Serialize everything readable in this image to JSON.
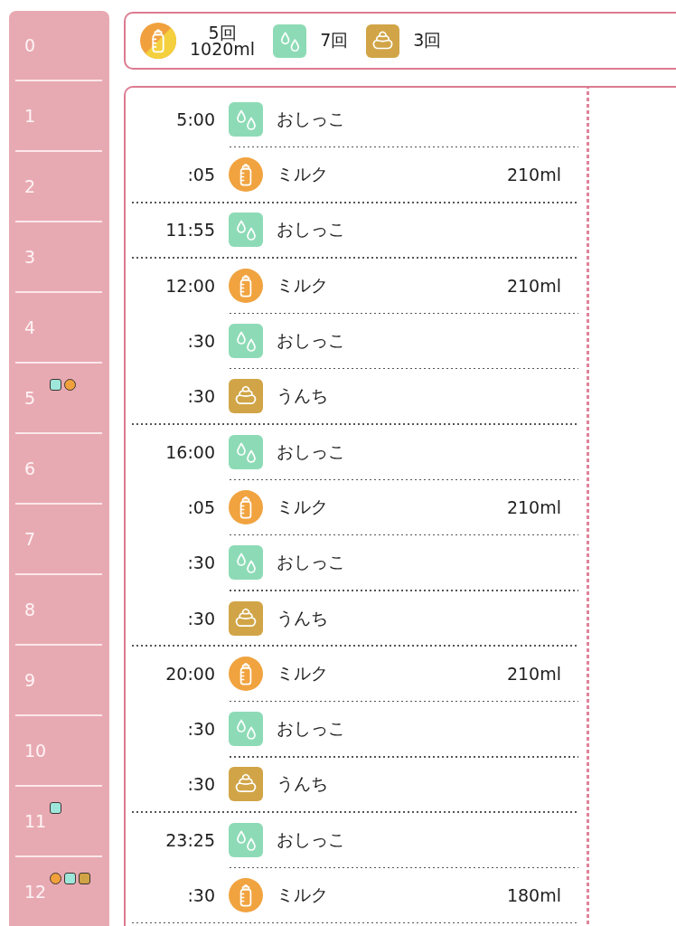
{
  "hours": [
    {
      "label": "0"
    },
    {
      "label": "1"
    },
    {
      "label": "2"
    },
    {
      "label": "3"
    },
    {
      "label": "4"
    },
    {
      "label": "5",
      "markers": [
        {
          "kind": "pee"
        },
        {
          "kind": "milk"
        }
      ]
    },
    {
      "label": "6"
    },
    {
      "label": "7"
    },
    {
      "label": "8"
    },
    {
      "label": "9"
    },
    {
      "label": "10"
    },
    {
      "label": "11",
      "markers": [
        {
          "kind": "pee"
        }
      ]
    },
    {
      "label": "12",
      "markers": [
        {
          "kind": "milk"
        },
        {
          "kind": "pee"
        },
        {
          "kind": "poop"
        }
      ]
    }
  ],
  "summary": {
    "items": [
      {
        "kind": "milk",
        "count": "5回",
        "amount": "1020ml"
      },
      {
        "kind": "pee",
        "count": "7回"
      },
      {
        "kind": "poop",
        "count": "3回"
      }
    ]
  },
  "log": {
    "groups": [
      {
        "entries": [
          {
            "time": "5:00",
            "kind": "pee",
            "label": "おしっこ"
          },
          {
            "time": ":05",
            "kind": "milk",
            "label": "ミルク",
            "amount": "210ml"
          }
        ]
      },
      {
        "entries": [
          {
            "time": "11:55",
            "kind": "pee",
            "label": "おしっこ"
          }
        ]
      },
      {
        "entries": [
          {
            "time": "12:00",
            "kind": "milk",
            "label": "ミルク",
            "amount": "210ml"
          },
          {
            "time": ":30",
            "kind": "pee",
            "label": "おしっこ"
          },
          {
            "time": ":30",
            "kind": "poop",
            "label": "うんち"
          }
        ]
      },
      {
        "entries": [
          {
            "time": "16:00",
            "kind": "pee",
            "label": "おしっこ"
          },
          {
            "time": ":05",
            "kind": "milk",
            "label": "ミルク",
            "amount": "210ml"
          },
          {
            "time": ":30",
            "kind": "pee",
            "label": "おしっこ"
          },
          {
            "time": ":30",
            "kind": "poop",
            "label": "うんち"
          }
        ]
      },
      {
        "entries": [
          {
            "time": "20:00",
            "kind": "milk",
            "label": "ミルク",
            "amount": "210ml"
          },
          {
            "time": ":30",
            "kind": "pee",
            "label": "おしっこ"
          },
          {
            "time": ":30",
            "kind": "poop",
            "label": "うんち"
          }
        ]
      },
      {
        "entries": [
          {
            "time": "23:25",
            "kind": "pee",
            "label": "おしっこ"
          },
          {
            "time": ":30",
            "kind": "milk",
            "label": "ミルク",
            "amount": "180ml"
          }
        ]
      }
    ]
  }
}
